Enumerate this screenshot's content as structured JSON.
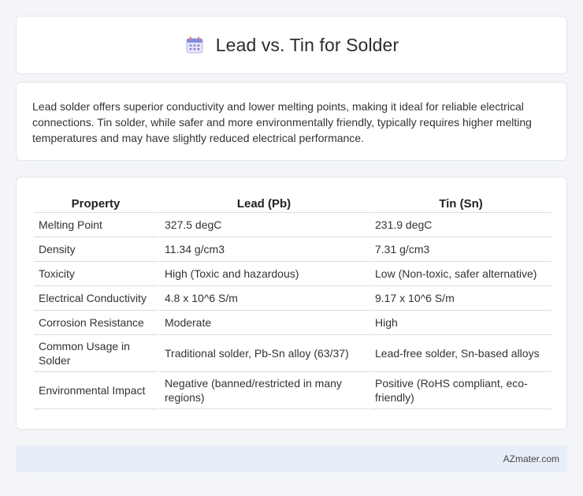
{
  "header": {
    "title": "Lead vs. Tin for Solder",
    "icon": "calendar-icon"
  },
  "description": {
    "text": "Lead solder offers superior conductivity and lower melting points, making it ideal for reliable electrical connections. Tin solder, while safer and more environmentally friendly, typically requires higher melting temperatures and may have slightly reduced electrical performance."
  },
  "table": {
    "columns": [
      "Property",
      "Lead (Pb)",
      "Tin (Sn)"
    ],
    "rows": [
      {
        "property": "Melting Point",
        "lead": "327.5 degC",
        "tin": "231.9 degC"
      },
      {
        "property": "Density",
        "lead": "11.34 g/cm3",
        "tin": "7.31 g/cm3"
      },
      {
        "property": "Toxicity",
        "lead": "High (Toxic and hazardous)",
        "tin": "Low (Non-toxic, safer alternative)"
      },
      {
        "property": "Electrical Conductivity",
        "lead": "4.8 x 10^6 S/m",
        "tin": "9.17 x 10^6 S/m"
      },
      {
        "property": "Corrosion Resistance",
        "lead": "Moderate",
        "tin": "High"
      },
      {
        "property": "Common Usage in Solder",
        "lead": "Traditional solder, Pb-Sn alloy (63/37)",
        "tin": "Lead-free solder, Sn-based alloys"
      },
      {
        "property": "Environmental Impact",
        "lead": "Negative (banned/restricted in many regions)",
        "tin": "Positive (RoHS compliant, eco-friendly)"
      }
    ]
  },
  "footer": {
    "text": "AZmater.com"
  },
  "colors": {
    "background": "#f3f5f8",
    "card": "#ffffff",
    "footer_band": "#e8eef8"
  }
}
